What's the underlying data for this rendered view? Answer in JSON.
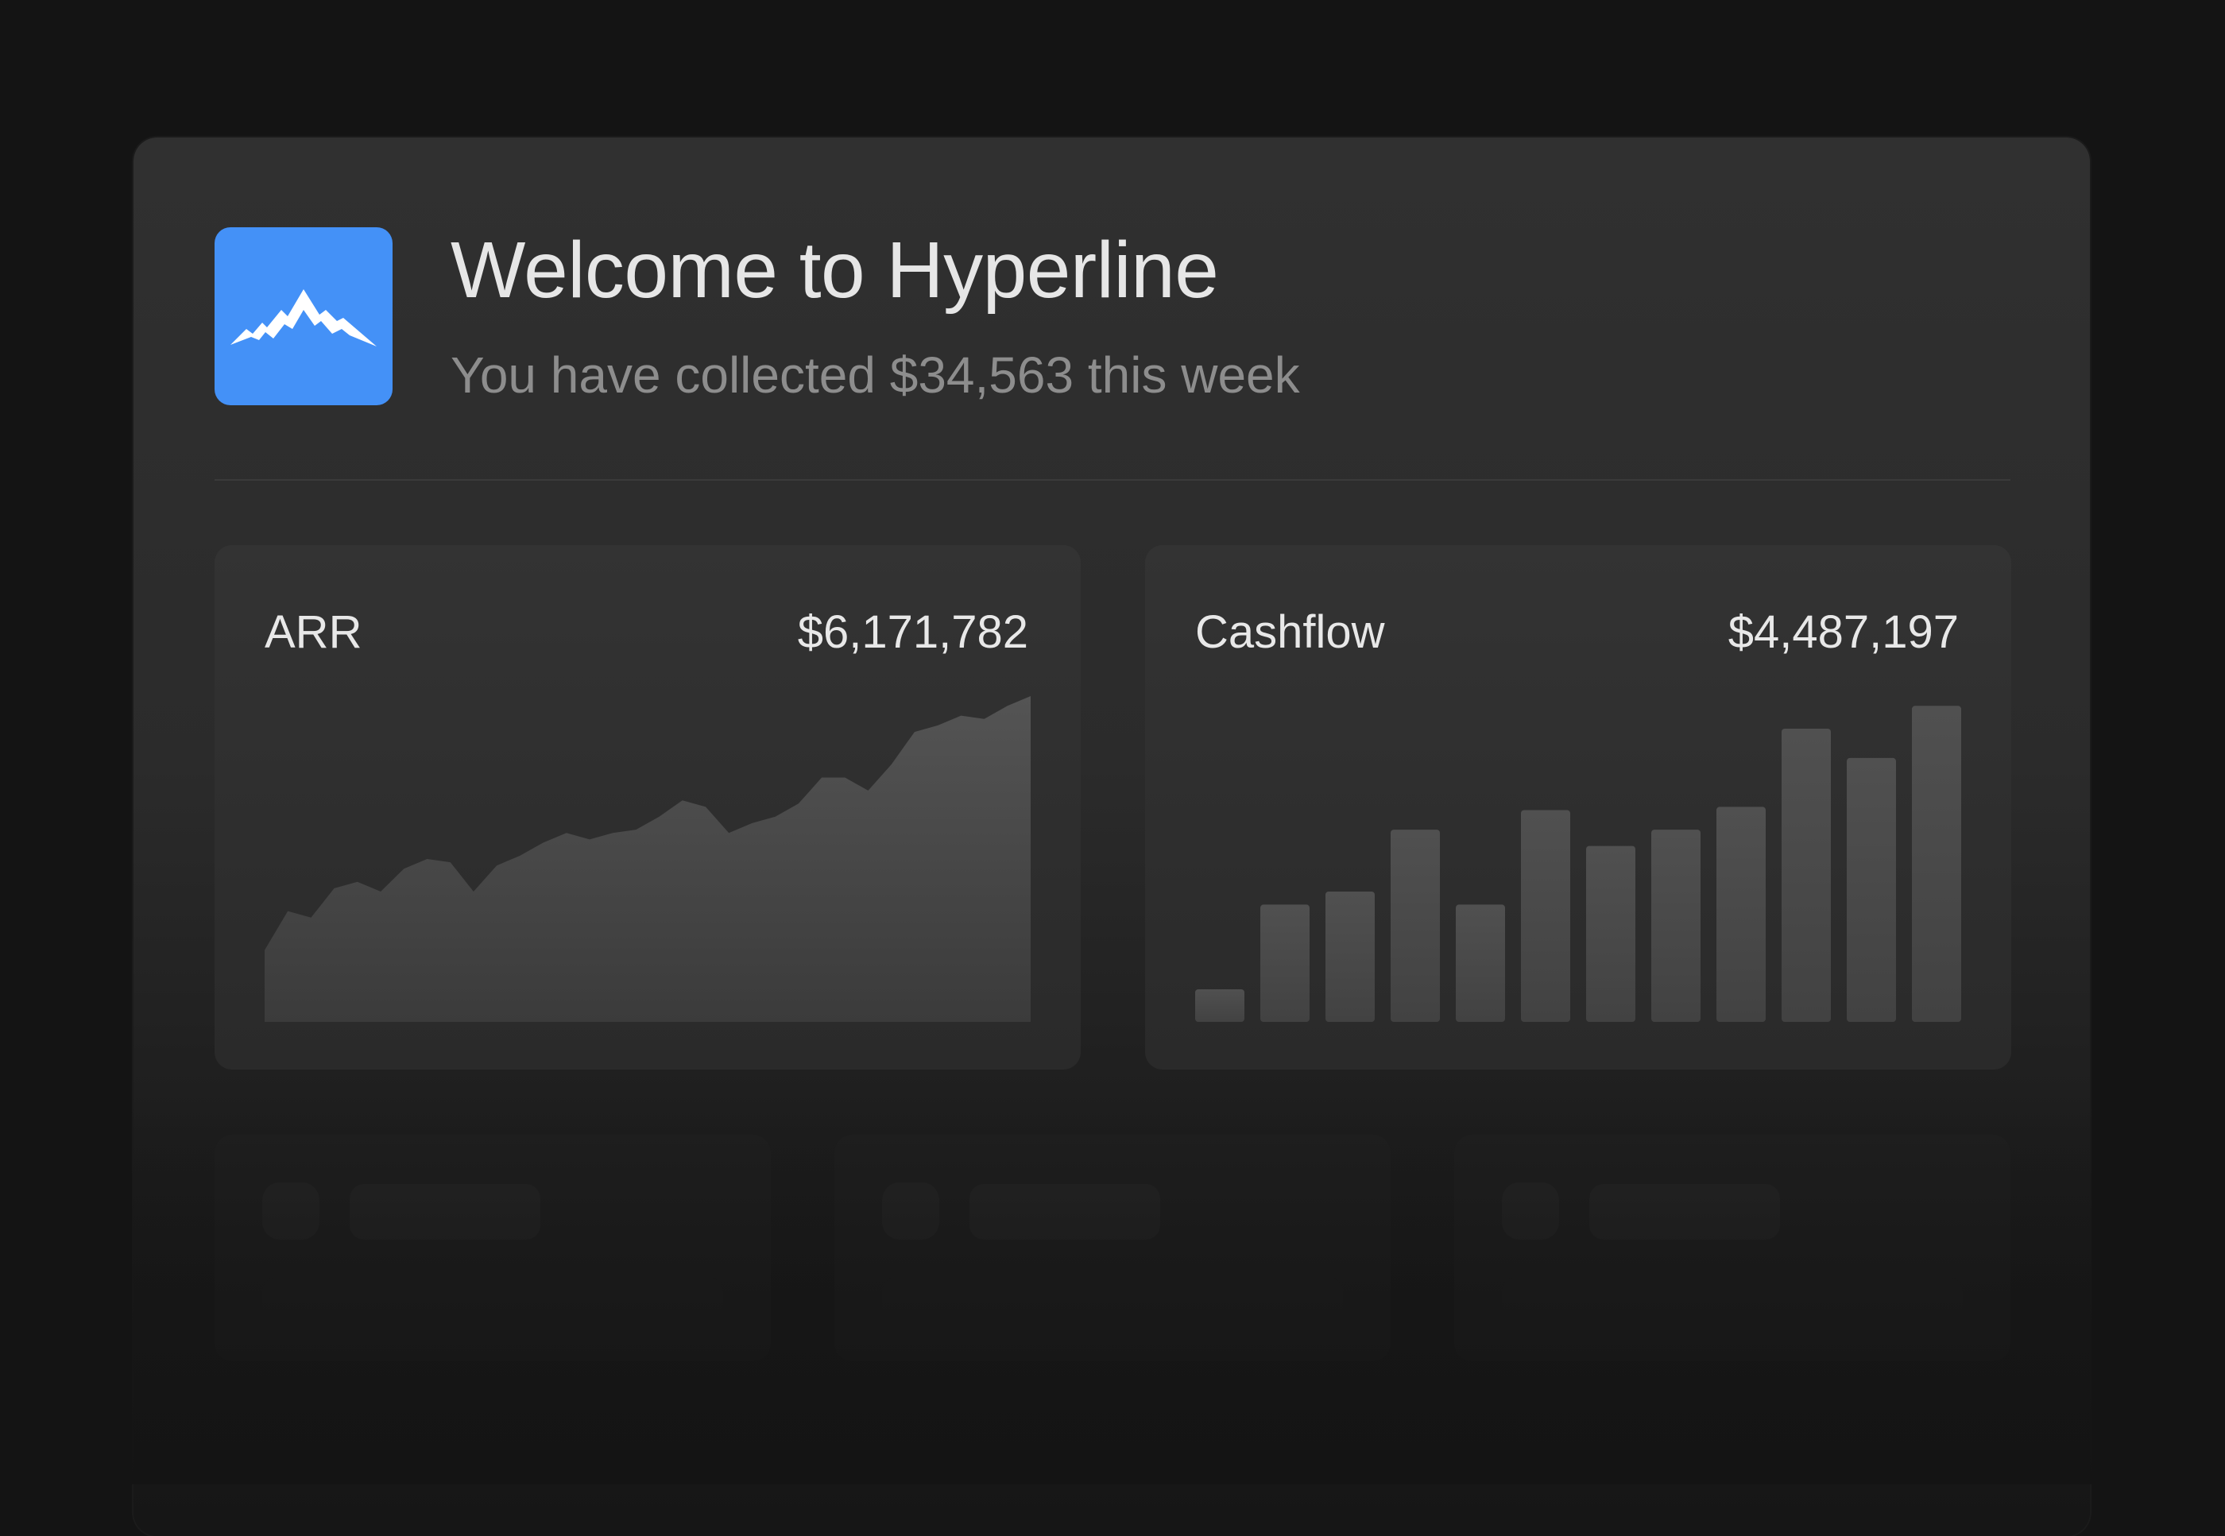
{
  "header": {
    "title": "Welcome to Hyperline",
    "subtitle": "You have collected $34,563 this week"
  },
  "icons": {
    "logo": "mountain-logo-icon"
  },
  "colors": {
    "background": "#141414",
    "panel": "#2e2e2e",
    "card": "#303030",
    "accent": "#4491f7",
    "text_primary": "#e6e6e6",
    "text_secondary": "#8d8d8d",
    "chart_fill": "#4a4a4a"
  },
  "cards": [
    {
      "label": "ARR",
      "value": "$6,171,782"
    },
    {
      "label": "Cashflow",
      "value": "$4,487,197"
    }
  ],
  "chart_data": [
    {
      "type": "area",
      "values": [
        22,
        34,
        32,
        41,
        43,
        40,
        47,
        50,
        49,
        40,
        48,
        51,
        55,
        58,
        56,
        58,
        59,
        63,
        68,
        66,
        58,
        61,
        63,
        67,
        75,
        75,
        71,
        79,
        89,
        91,
        94,
        93,
        97,
        100
      ],
      "ylim": [
        0,
        100
      ]
    },
    {
      "type": "bar",
      "values": [
        10,
        36,
        40,
        59,
        36,
        65,
        54,
        59,
        66,
        90,
        81,
        97
      ],
      "ylim": [
        0,
        100
      ]
    }
  ]
}
